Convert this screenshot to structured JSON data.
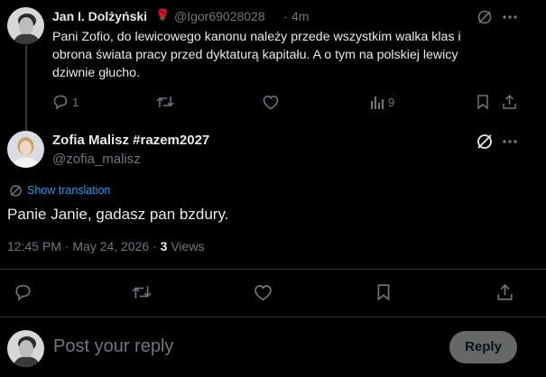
{
  "parent_tweet": {
    "name": "Jan I. Dolżyński",
    "rose_emoji": "🌹",
    "handle": "@Igor69028028",
    "sep": "·",
    "time": "4m",
    "text": "Pani Zofio, do lewicowego kanonu należy przede wszystkim walka klas i obrona świata pracy przed dyktaturą kapitału. A o tym na polskiej lewicy dziwnie głucho.",
    "reply_count": "1",
    "views_count": "9"
  },
  "main_tweet": {
    "name": "Zofia Malisz #razem2027",
    "handle": "@zofia_malisz",
    "show_translation": "Show translation",
    "text": "Panie Janie, gadasz pan bzdury.",
    "timestamp": "12:45 PM · May 24, 2026 ·",
    "views_number": "3",
    "views_label": "Views"
  },
  "composer": {
    "placeholder": "Post your reply",
    "reply_label": "Reply"
  },
  "colors": {
    "background": "#000000",
    "text": "#e7e9ea",
    "muted": "#71767b",
    "link": "#1d9bf0",
    "divider": "#2f3336"
  }
}
